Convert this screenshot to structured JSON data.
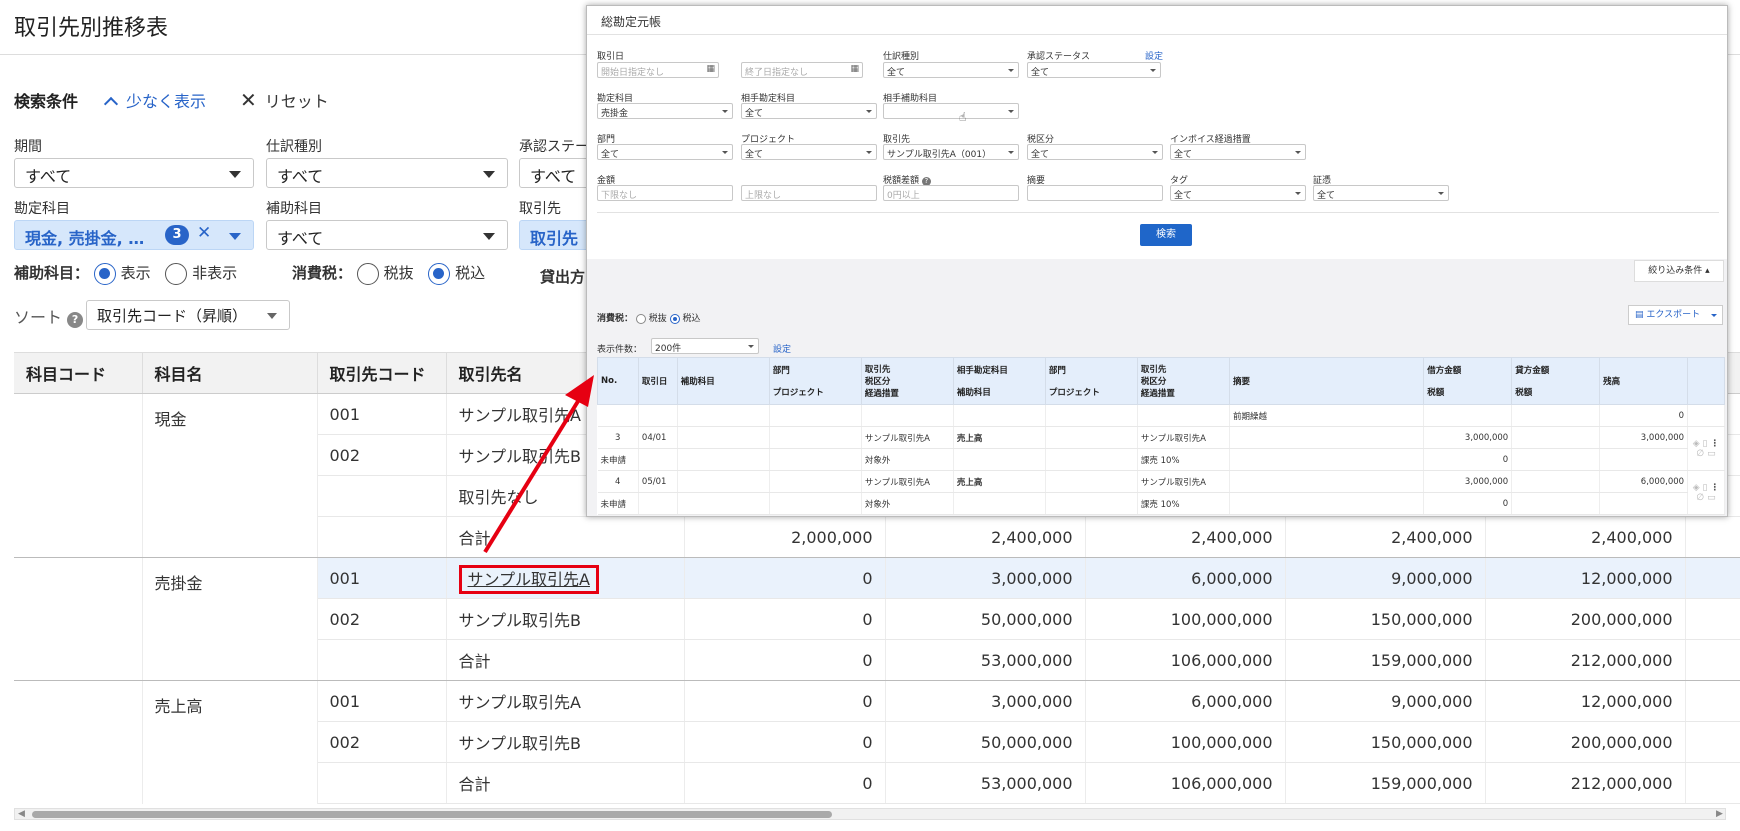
{
  "page_title": "取引先別推移表",
  "search": {
    "label": "検索条件",
    "toggle_label": "少なく表示",
    "reset_label": "リセット",
    "period_label": "期間",
    "period_value": "すべて",
    "journal_type_label": "仕訳種別",
    "journal_type_value": "すべて",
    "approval_label": "承認ステー",
    "approval_value": "すべて",
    "account_label": "勘定科目",
    "account_value": "現金, 売掛金, …",
    "account_count": "3",
    "sub_account_label": "補助科目",
    "sub_account_value": "すべて",
    "partner_label": "取引先",
    "partner_value": "取引先な",
    "sub_display_label": "補助科目：",
    "sub_show": "表示",
    "sub_hide": "非表示",
    "tax_label": "消費税：",
    "tax_excl": "税抜",
    "tax_incl": "税込",
    "calc_label": "貸出方",
    "sort_label": "ソート",
    "sort_value": "取引先コード（昇順）"
  },
  "table": {
    "headers": [
      "科目コード",
      "科目名",
      "取引先コード",
      "取引先名"
    ],
    "groups": [
      {
        "account": "現金",
        "rows": [
          {
            "code": "001",
            "name": "サンプル取引先A",
            "vals": []
          },
          {
            "code": "002",
            "name": "サンプル取引先B",
            "vals": []
          },
          {
            "code": "",
            "name": "取引先なし",
            "vals": []
          },
          {
            "code": "",
            "name": "合計",
            "vals": [
              "2,000,000",
              "2,400,000",
              "2,400,000",
              "2,400,000",
              "2,400,000"
            ]
          }
        ]
      },
      {
        "account": "売掛金",
        "rows": [
          {
            "code": "001",
            "name": "サンプル取引先A",
            "vals": [
              "0",
              "3,000,000",
              "6,000,000",
              "9,000,000",
              "12,000,000"
            ]
          },
          {
            "code": "002",
            "name": "サンプル取引先B",
            "vals": [
              "0",
              "50,000,000",
              "100,000,000",
              "150,000,000",
              "200,000,000"
            ]
          },
          {
            "code": "",
            "name": "合計",
            "vals": [
              "0",
              "53,000,000",
              "106,000,000",
              "159,000,000",
              "212,000,000"
            ]
          }
        ]
      },
      {
        "account": "売上高",
        "rows": [
          {
            "code": "001",
            "name": "サンプル取引先A",
            "vals": [
              "0",
              "3,000,000",
              "6,000,000",
              "9,000,000",
              "12,000,000"
            ]
          },
          {
            "code": "002",
            "name": "サンプル取引先B",
            "vals": [
              "0",
              "50,000,000",
              "100,000,000",
              "150,000,000",
              "200,000,000"
            ]
          },
          {
            "code": "",
            "name": "合計",
            "vals": [
              "0",
              "53,000,000",
              "106,000,000",
              "159,000,000",
              "212,000,000"
            ]
          }
        ]
      }
    ]
  },
  "popup": {
    "title": "総勘定元帳",
    "date_label": "取引日",
    "date_start_ph": "開始日指定なし",
    "date_end_ph": "終了日指定なし",
    "journal_type_label": "仕訳種別",
    "journal_type_value": "全て",
    "approval_label": "承認ステータス",
    "settings_link": "設定",
    "approval_value": "全て",
    "account_label": "勘定科目",
    "account_value": "売掛金",
    "counter_account_label": "相手勘定科目",
    "counter_account_value": "全て",
    "counter_sub_label": "相手補助科目",
    "counter_sub_value": "",
    "dept_label": "部門",
    "dept_value": "全て",
    "project_label": "プロジェクト",
    "project_value": "全て",
    "partner_label": "取引先",
    "partner_value": "サンプル取引先A（001）",
    "tax_class_label": "税区分",
    "tax_class_value": "全て",
    "invoice_label": "インボイス経過措置",
    "invoice_value": "全て",
    "amount_label": "金額",
    "amount_min_ph": "下限なし",
    "amount_max_ph": "上限なし",
    "tax_diff_label": "税額差額",
    "tax_diff_ph": "0円以上",
    "memo_label": "摘要",
    "tag_label": "タグ",
    "tag_value": "全て",
    "evidence_label": "証憑",
    "evidence_value": "全て",
    "search_button": "検索",
    "filter_button": "絞り込み条件 ▴",
    "tax_label": "消費税：",
    "tax_excl": "税抜",
    "tax_incl": "税込",
    "export_button": "エクスポート",
    "count_label": "表示件数：",
    "count_value": "200件",
    "count_settings": "設定",
    "headers": {
      "no": "No.",
      "date": "取引日",
      "sub": "補助科目",
      "dept1": "部門",
      "proj1": "プロジェクト",
      "partner1": "取引先",
      "taxc1": "税区分",
      "trans1": "経過措置",
      "counter": "相手勘定科目",
      "counter_sub": "補助科目",
      "dept2": "部門",
      "proj2": "プロジェクト",
      "partner2": "取引先",
      "taxc2": "税区分",
      "trans2": "経過措置",
      "memo": "摘要",
      "debit": "借方金額",
      "debit_tax": "税額",
      "credit": "貸方金額",
      "credit_tax": "税額",
      "balance": "残高"
    },
    "carry": {
      "memo": "前期繰越",
      "balance": "0"
    },
    "rows": [
      {
        "no": "3",
        "status": "未申請",
        "date": "04/01",
        "partner": "サンプル取引先A",
        "taxc": "対象外",
        "counter": "売上高",
        "partner2": "サンプル取引先A",
        "taxc2": "課売 10%",
        "debit": "3,000,000",
        "debit_tax": "0",
        "balance": "3,000,000"
      },
      {
        "no": "4",
        "status": "未申請",
        "date": "05/01",
        "partner": "サンプル取引先A",
        "taxc": "対象外",
        "counter": "売上高",
        "partner2": "サンプル取引先A",
        "taxc2": "課売 10%",
        "debit": "3,000,000",
        "debit_tax": "0",
        "balance": "6,000,000"
      }
    ]
  },
  "colors": {
    "accent": "#2864c8",
    "highlight": "#e60012"
  }
}
